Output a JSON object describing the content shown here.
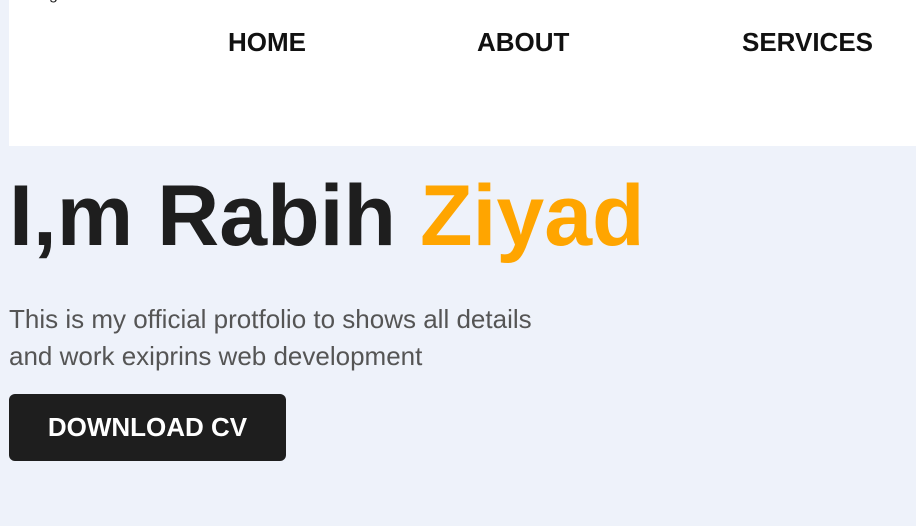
{
  "nav": {
    "logo_fragment": "g",
    "links": [
      "HOME",
      "ABOUT",
      "SERVICES"
    ]
  },
  "hero": {
    "title_prefix": "I,m Rabih ",
    "title_accent": "Ziyad",
    "description": "This is my official protfolio to shows all details and work exiprins web development",
    "button_label": "DOWNLOAD CV"
  },
  "colors": {
    "background": "#eef2fa",
    "navbar": "#ffffff",
    "accent": "#ffa500",
    "button": "#1e1e1e",
    "text_dark": "#1e1e1e",
    "text_muted": "#555555"
  }
}
